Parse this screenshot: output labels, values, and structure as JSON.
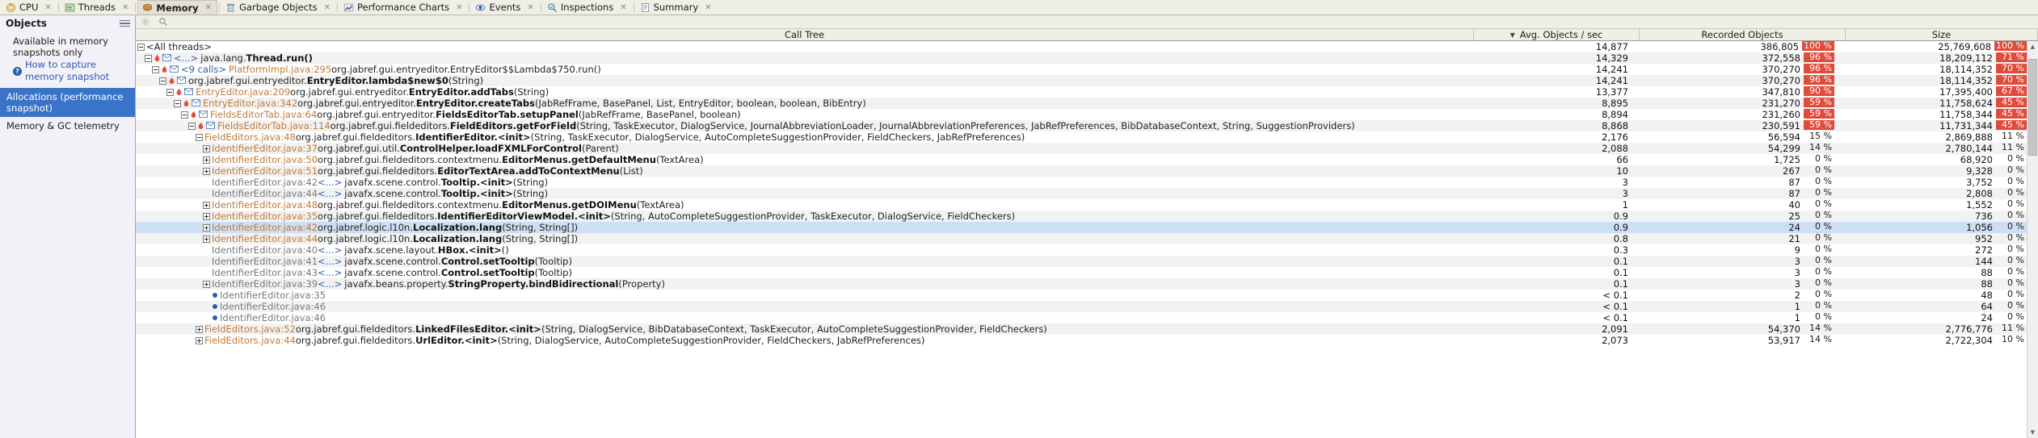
{
  "tabs": [
    {
      "label": "CPU",
      "icon": "cpu-icon",
      "active": false,
      "closable": true
    },
    {
      "label": "Threads",
      "icon": "threads-icon",
      "active": false,
      "closable": true
    },
    {
      "label": "Memory",
      "icon": "memory-icon",
      "active": true,
      "closable": true
    },
    {
      "label": "Garbage Objects",
      "icon": "trash-icon",
      "active": false,
      "closable": true
    },
    {
      "label": "Performance Charts",
      "icon": "chart-icon",
      "active": false,
      "closable": true
    },
    {
      "label": "Events",
      "icon": "eye-icon",
      "active": false,
      "closable": true
    },
    {
      "label": "Inspections",
      "icon": "inspections-icon",
      "active": false,
      "closable": true
    },
    {
      "label": "Summary",
      "icon": "summary-icon",
      "active": false,
      "closable": true
    }
  ],
  "sidebar": {
    "title": "Objects",
    "menu_icon": "hamburger-icon",
    "note": "Available in memory snapshots only",
    "help_link": "How to capture memory snapshot",
    "help_icon": "question-icon",
    "items": [
      {
        "label": "Allocations (performance snapshot)",
        "selected": true
      },
      {
        "label": "Memory & GC telemetry",
        "selected": false
      }
    ]
  },
  "toolbar": {
    "settings_icon": "gear-icon",
    "search_icon": "search-icon"
  },
  "columns": {
    "call_tree": "Call Tree",
    "avg_objects": "Avg. Objects / sec",
    "recorded_objects": "Recorded Objects",
    "size": "Size",
    "sort_indicator": "▼"
  },
  "rows": [
    {
      "indent": 0,
      "kind": "root",
      "expander": "expanded",
      "text_parts": [
        {
          "t": "<All threads>",
          "c": "sig"
        }
      ],
      "avg": "14,877",
      "rec": "386,805",
      "rec_pct": "100 %",
      "rec_hot": true,
      "size": "25,769,608",
      "size_pct": "100 %",
      "size_hot": true,
      "selected": false
    },
    {
      "indent": 1,
      "kind": "thread",
      "expander": "expanded",
      "icon": "flame",
      "env": true,
      "ell": "<...>",
      "text_parts": [
        {
          "t": "java.lang.",
          "c": "pkg"
        },
        {
          "t": "Thread.run()",
          "c": "mth"
        }
      ],
      "avg": "14,329",
      "rec": "372,558",
      "rec_pct": "96 %",
      "rec_hot": true,
      "size": "18,209,112",
      "size_pct": "71 %",
      "size_hot": true,
      "selected": false
    },
    {
      "indent": 2,
      "kind": "calls",
      "expander": "expanded",
      "icon": "flame",
      "env": true,
      "pre": "<9 calls>",
      "text_parts": [
        {
          "t": "PlatformImpl.java:295",
          "c": "loc"
        },
        {
          "t": " ",
          "c": "sig"
        },
        {
          "t": "org.jabref.gui.entryeditor.EntryEditor$$Lambda$750.run()",
          "c": "sig"
        }
      ],
      "avg": "14,241",
      "rec": "370,270",
      "rec_pct": "96 %",
      "rec_hot": true,
      "size": "18,114,352",
      "size_pct": "70 %",
      "size_hot": true,
      "selected": false
    },
    {
      "indent": 3,
      "kind": "m",
      "expander": "expanded",
      "icon": "flame",
      "env": true,
      "text_parts": [
        {
          "t": "org.jabref.gui.entryeditor.",
          "c": "pkg"
        },
        {
          "t": "EntryEditor.lambda$new$0",
          "c": "mth"
        },
        {
          "t": "(String)",
          "c": "sig"
        }
      ],
      "avg": "14,241",
      "rec": "370,270",
      "rec_pct": "96 %",
      "rec_hot": true,
      "size": "18,114,352",
      "size_pct": "70 %",
      "size_hot": true,
      "selected": false
    },
    {
      "indent": 4,
      "kind": "m",
      "expander": "expanded",
      "icon": "flame",
      "env": true,
      "loc": "EntryEditor.java:209",
      "text_parts": [
        {
          "t": "org.jabref.gui.entryeditor.",
          "c": "pkg"
        },
        {
          "t": "EntryEditor.addTabs",
          "c": "mth"
        },
        {
          "t": "(String)",
          "c": "sig"
        }
      ],
      "avg": "13,377",
      "rec": "347,810",
      "rec_pct": "90 %",
      "rec_hot": true,
      "size": "17,395,400",
      "size_pct": "67 %",
      "size_hot": true,
      "selected": false
    },
    {
      "indent": 5,
      "kind": "m",
      "expander": "expanded",
      "icon": "flame",
      "env": true,
      "loc": "EntryEditor.java:342",
      "text_parts": [
        {
          "t": "org.jabref.gui.entryeditor.",
          "c": "pkg"
        },
        {
          "t": "EntryEditor.createTabs",
          "c": "mth"
        },
        {
          "t": "(JabRefFrame, BasePanel, List, EntryEditor, boolean, boolean, BibEntry)",
          "c": "sig"
        }
      ],
      "avg": "8,895",
      "rec": "231,270",
      "rec_pct": "59 %",
      "rec_hot": true,
      "size": "11,758,624",
      "size_pct": "45 %",
      "size_hot": true,
      "selected": false
    },
    {
      "indent": 6,
      "kind": "m",
      "expander": "expanded",
      "icon": "flame",
      "env": true,
      "loc": "FieldsEditorTab.java:64",
      "text_parts": [
        {
          "t": "org.jabref.gui.entryeditor.",
          "c": "pkg"
        },
        {
          "t": "FieldsEditorTab.setupPanel",
          "c": "mth"
        },
        {
          "t": "(JabRefFrame, BasePanel, boolean)",
          "c": "sig"
        }
      ],
      "avg": "8,894",
      "rec": "231,260",
      "rec_pct": "59 %",
      "rec_hot": true,
      "size": "11,758,344",
      "size_pct": "45 %",
      "size_hot": true,
      "selected": false
    },
    {
      "indent": 7,
      "kind": "m",
      "expander": "expanded",
      "icon": "flame",
      "env": true,
      "loc": "FieldsEditorTab.java:114",
      "text_parts": [
        {
          "t": "org.jabref.gui.fieldeditors.",
          "c": "pkg"
        },
        {
          "t": "FieldEditors.getForField",
          "c": "mth"
        },
        {
          "t": "(String, TaskExecutor, DialogService, JournalAbbreviationLoader, JournalAbbreviationPreferences, JabRefPreferences, BibDatabaseContext, String, SuggestionProviders)",
          "c": "sig"
        }
      ],
      "avg": "8,868",
      "rec": "230,591",
      "rec_pct": "59 %",
      "rec_hot": true,
      "size": "11,731,344",
      "size_pct": "45 %",
      "size_hot": true,
      "selected": false
    },
    {
      "indent": 8,
      "kind": "m",
      "expander": "expanded",
      "icon": "none",
      "loc": "FieldEditors.java:48",
      "text_parts": [
        {
          "t": "org.jabref.gui.fieldeditors.",
          "c": "pkg"
        },
        {
          "t": "IdentifierEditor.<init>",
          "c": "mth"
        },
        {
          "t": "(String, TaskExecutor, DialogService, AutoCompleteSuggestionProvider, FieldCheckers, JabRefPreferences)",
          "c": "sig"
        }
      ],
      "avg": "2,176",
      "rec": "56,594",
      "rec_pct": "15 %",
      "rec_hot": false,
      "size": "2,869,888",
      "size_pct": "11 %",
      "size_hot": false,
      "selected": false
    },
    {
      "indent": 9,
      "kind": "m",
      "expander": "collapsed",
      "icon": "none",
      "loc": "IdentifierEditor.java:37",
      "text_parts": [
        {
          "t": "org.jabref.gui.util.",
          "c": "pkg"
        },
        {
          "t": "ControlHelper.loadFXMLForControl",
          "c": "mth"
        },
        {
          "t": "(Parent)",
          "c": "sig"
        }
      ],
      "avg": "2,088",
      "rec": "54,299",
      "rec_pct": "14 %",
      "rec_hot": false,
      "size": "2,780,144",
      "size_pct": "11 %",
      "size_hot": false,
      "selected": false
    },
    {
      "indent": 9,
      "kind": "m",
      "expander": "collapsed",
      "icon": "none",
      "loc": "IdentifierEditor.java:50",
      "text_parts": [
        {
          "t": "org.jabref.gui.fieldeditors.contextmenu.",
          "c": "pkg"
        },
        {
          "t": "EditorMenus.getDefaultMenu",
          "c": "mth"
        },
        {
          "t": "(TextArea)",
          "c": "sig"
        }
      ],
      "avg": "66",
      "rec": "1,725",
      "rec_pct": "0 %",
      "rec_hot": false,
      "size": "68,920",
      "size_pct": "0 %",
      "size_hot": false,
      "selected": false
    },
    {
      "indent": 9,
      "kind": "m",
      "expander": "collapsed",
      "icon": "none",
      "loc": "IdentifierEditor.java:51",
      "text_parts": [
        {
          "t": "org.jabref.gui.fieldeditors.",
          "c": "pkg"
        },
        {
          "t": "EditorTextArea.addToContextMenu",
          "c": "mth"
        },
        {
          "t": "(List)",
          "c": "sig"
        }
      ],
      "avg": "10",
      "rec": "267",
      "rec_pct": "0 %",
      "rec_hot": false,
      "size": "9,328",
      "size_pct": "0 %",
      "size_hot": false,
      "selected": false
    },
    {
      "indent": 9,
      "kind": "m",
      "expander": "none",
      "icon": "none",
      "locgray": "IdentifierEditor.java:42",
      "ell": "<...>",
      "text_parts": [
        {
          "t": "javafx.scene.control.",
          "c": "pkg"
        },
        {
          "t": "Tooltip.<init>",
          "c": "mth"
        },
        {
          "t": "(String)",
          "c": "sig"
        }
      ],
      "avg": "3",
      "rec": "87",
      "rec_pct": "0 %",
      "rec_hot": false,
      "size": "3,752",
      "size_pct": "0 %",
      "size_hot": false,
      "selected": false
    },
    {
      "indent": 9,
      "kind": "m",
      "expander": "none",
      "icon": "none",
      "locgray": "IdentifierEditor.java:44",
      "ell": "<...>",
      "text_parts": [
        {
          "t": "javafx.scene.control.",
          "c": "pkg"
        },
        {
          "t": "Tooltip.<init>",
          "c": "mth"
        },
        {
          "t": "(String)",
          "c": "sig"
        }
      ],
      "avg": "3",
      "rec": "87",
      "rec_pct": "0 %",
      "rec_hot": false,
      "size": "2,808",
      "size_pct": "0 %",
      "size_hot": false,
      "selected": false
    },
    {
      "indent": 9,
      "kind": "m",
      "expander": "collapsed",
      "icon": "none",
      "loc": "IdentifierEditor.java:48",
      "text_parts": [
        {
          "t": "org.jabref.gui.fieldeditors.contextmenu.",
          "c": "pkg"
        },
        {
          "t": "EditorMenus.getDOIMenu",
          "c": "mth"
        },
        {
          "t": "(TextArea)",
          "c": "sig"
        }
      ],
      "avg": "1",
      "rec": "40",
      "rec_pct": "0 %",
      "rec_hot": false,
      "size": "1,552",
      "size_pct": "0 %",
      "size_hot": false,
      "selected": false
    },
    {
      "indent": 9,
      "kind": "m",
      "expander": "collapsed",
      "icon": "none",
      "loc": "IdentifierEditor.java:35",
      "text_parts": [
        {
          "t": "org.jabref.gui.fieldeditors.",
          "c": "pkg"
        },
        {
          "t": "IdentifierEditorViewModel.<init>",
          "c": "mth"
        },
        {
          "t": "(String, AutoCompleteSuggestionProvider, TaskExecutor, DialogService, FieldCheckers)",
          "c": "sig"
        }
      ],
      "avg": "0.9",
      "rec": "25",
      "rec_pct": "0 %",
      "rec_hot": false,
      "size": "736",
      "size_pct": "0 %",
      "size_hot": false,
      "selected": false
    },
    {
      "indent": 9,
      "kind": "m",
      "expander": "collapsed",
      "icon": "none",
      "loc": "IdentifierEditor.java:42",
      "text_parts": [
        {
          "t": "org.jabref.logic.l10n.",
          "c": "pkg"
        },
        {
          "t": "Localization.lang",
          "c": "mth"
        },
        {
          "t": "(String, String[])",
          "c": "sig"
        }
      ],
      "avg": "0.9",
      "rec": "24",
      "rec_pct": "0 %",
      "rec_hot": false,
      "size": "1,056",
      "size_pct": "0 %",
      "size_hot": false,
      "selected": true
    },
    {
      "indent": 9,
      "kind": "m",
      "expander": "collapsed",
      "icon": "none",
      "loc": "IdentifierEditor.java:44",
      "text_parts": [
        {
          "t": "org.jabref.logic.l10n.",
          "c": "pkg"
        },
        {
          "t": "Localization.lang",
          "c": "mth"
        },
        {
          "t": "(String, String[])",
          "c": "sig"
        }
      ],
      "avg": "0.8",
      "rec": "21",
      "rec_pct": "0 %",
      "rec_hot": false,
      "size": "952",
      "size_pct": "0 %",
      "size_hot": false,
      "selected": false
    },
    {
      "indent": 9,
      "kind": "m",
      "expander": "none",
      "icon": "none",
      "locgray": "IdentifierEditor.java:40",
      "ell": "<...>",
      "text_parts": [
        {
          "t": "javafx.scene.layout.",
          "c": "pkg"
        },
        {
          "t": "HBox.<init>",
          "c": "mth"
        },
        {
          "t": "()",
          "c": "sig"
        }
      ],
      "avg": "0.3",
      "rec": "9",
      "rec_pct": "0 %",
      "rec_hot": false,
      "size": "272",
      "size_pct": "0 %",
      "size_hot": false,
      "selected": false
    },
    {
      "indent": 9,
      "kind": "m",
      "expander": "none",
      "icon": "none",
      "locgray": "IdentifierEditor.java:41",
      "ell": "<...>",
      "text_parts": [
        {
          "t": "javafx.scene.control.",
          "c": "pkg"
        },
        {
          "t": "Control.setTooltip",
          "c": "mth"
        },
        {
          "t": "(Tooltip)",
          "c": "sig"
        }
      ],
      "avg": "0.1",
      "rec": "3",
      "rec_pct": "0 %",
      "rec_hot": false,
      "size": "144",
      "size_pct": "0 %",
      "size_hot": false,
      "selected": false
    },
    {
      "indent": 9,
      "kind": "m",
      "expander": "none",
      "icon": "none",
      "locgray": "IdentifierEditor.java:43",
      "ell": "<...>",
      "text_parts": [
        {
          "t": "javafx.scene.control.",
          "c": "pkg"
        },
        {
          "t": "Control.setTooltip",
          "c": "mth"
        },
        {
          "t": "(Tooltip)",
          "c": "sig"
        }
      ],
      "avg": "0.1",
      "rec": "3",
      "rec_pct": "0 %",
      "rec_hot": false,
      "size": "88",
      "size_pct": "0 %",
      "size_hot": false,
      "selected": false
    },
    {
      "indent": 9,
      "kind": "m",
      "expander": "collapsed",
      "icon": "none",
      "locgray": "IdentifierEditor.java:39",
      "ell": "<...>",
      "text_parts": [
        {
          "t": "javafx.beans.property.",
          "c": "pkg"
        },
        {
          "t": "StringProperty.bindBidirectional",
          "c": "mth"
        },
        {
          "t": "(Property)",
          "c": "sig"
        }
      ],
      "avg": "0.1",
      "rec": "3",
      "rec_pct": "0 %",
      "rec_hot": false,
      "size": "88",
      "size_pct": "0 %",
      "size_hot": false,
      "selected": false
    },
    {
      "indent": 9,
      "kind": "leaf",
      "expander": "none",
      "icon": "dot",
      "locgray": "IdentifierEditor.java:35",
      "text_parts": [],
      "avg": "< 0.1",
      "rec": "2",
      "rec_pct": "0 %",
      "rec_hot": false,
      "size": "48",
      "size_pct": "0 %",
      "size_hot": false,
      "selected": false
    },
    {
      "indent": 9,
      "kind": "leaf",
      "expander": "none",
      "icon": "dot",
      "locgray": "IdentifierEditor.java:46",
      "text_parts": [],
      "avg": "< 0.1",
      "rec": "1",
      "rec_pct": "0 %",
      "rec_hot": false,
      "size": "64",
      "size_pct": "0 %",
      "size_hot": false,
      "selected": false
    },
    {
      "indent": 9,
      "kind": "leaf",
      "expander": "none",
      "icon": "dot",
      "locgray": "IdentifierEditor.java:46",
      "text_parts": [],
      "avg": "< 0.1",
      "rec": "1",
      "rec_pct": "0 %",
      "rec_hot": false,
      "size": "24",
      "size_pct": "0 %",
      "size_hot": false,
      "selected": false
    },
    {
      "indent": 8,
      "kind": "m",
      "expander": "collapsed",
      "icon": "none",
      "loc": "FieldEditors.java:52",
      "text_parts": [
        {
          "t": "org.jabref.gui.fieldeditors.",
          "c": "pkg"
        },
        {
          "t": "LinkedFilesEditor.<init>",
          "c": "mth"
        },
        {
          "t": "(String, DialogService, BibDatabaseContext, TaskExecutor, AutoCompleteSuggestionProvider, FieldCheckers)",
          "c": "sig"
        }
      ],
      "avg": "2,091",
      "rec": "54,370",
      "rec_pct": "14 %",
      "rec_hot": false,
      "size": "2,776,776",
      "size_pct": "11 %",
      "size_hot": false,
      "selected": false
    },
    {
      "indent": 8,
      "kind": "m",
      "expander": "collapsed",
      "icon": "none",
      "loc": "FieldEditors.java:44",
      "text_parts": [
        {
          "t": "org.jabref.gui.fieldeditors.",
          "c": "pkg"
        },
        {
          "t": "UrlEditor.<init>",
          "c": "mth"
        },
        {
          "t": "(String, DialogService, AutoCompleteSuggestionProvider, FieldCheckers, JabRefPreferences)",
          "c": "sig"
        }
      ],
      "avg": "2,073",
      "rec": "53,917",
      "rec_pct": "14 %",
      "rec_hot": false,
      "size": "2,722,304",
      "size_pct": "10 %",
      "size_hot": false,
      "selected": false
    }
  ],
  "scrollbar": {
    "up": "▲",
    "down": "▼"
  }
}
